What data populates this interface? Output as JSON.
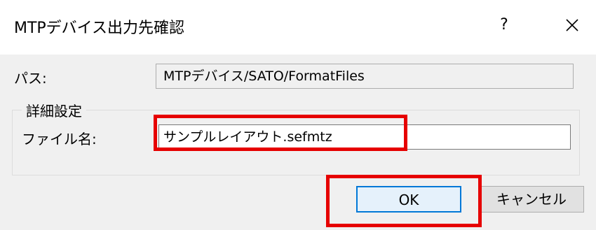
{
  "window": {
    "title": "MTPデバイス出力先確認",
    "help_label": "?",
    "close_icon": "close-icon"
  },
  "path": {
    "label": "パス:",
    "value": "MTPデバイス/SATO/FormatFiles"
  },
  "details": {
    "group_label": "詳細設定",
    "filename_label": "ファイル名:",
    "filename_value": "サンプルレイアウト.sefmtz"
  },
  "buttons": {
    "ok_label": "OK",
    "cancel_label": "キャンセル"
  },
  "colors": {
    "highlight": "#e60000",
    "ok_border": "#0078d7"
  }
}
